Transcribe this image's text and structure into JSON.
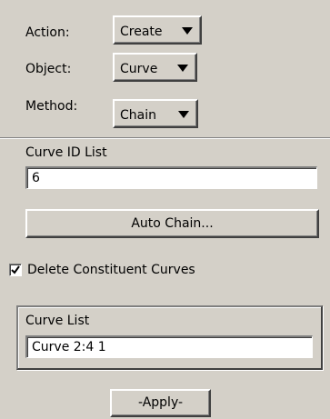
{
  "form": {
    "action_label": "Action:",
    "action_value": "Create",
    "object_label": "Object:",
    "object_value": "Curve",
    "method_label": "Method:",
    "method_value": "Chain"
  },
  "curve_id_list": {
    "label": "Curve ID List",
    "value": "6"
  },
  "auto_chain_label": "Auto Chain...",
  "delete_constituent": {
    "label": "Delete Constituent Curves",
    "checked": true
  },
  "curve_list": {
    "label": "Curve List",
    "value": "Curve 2:4 1"
  },
  "apply_label": "-Apply-"
}
